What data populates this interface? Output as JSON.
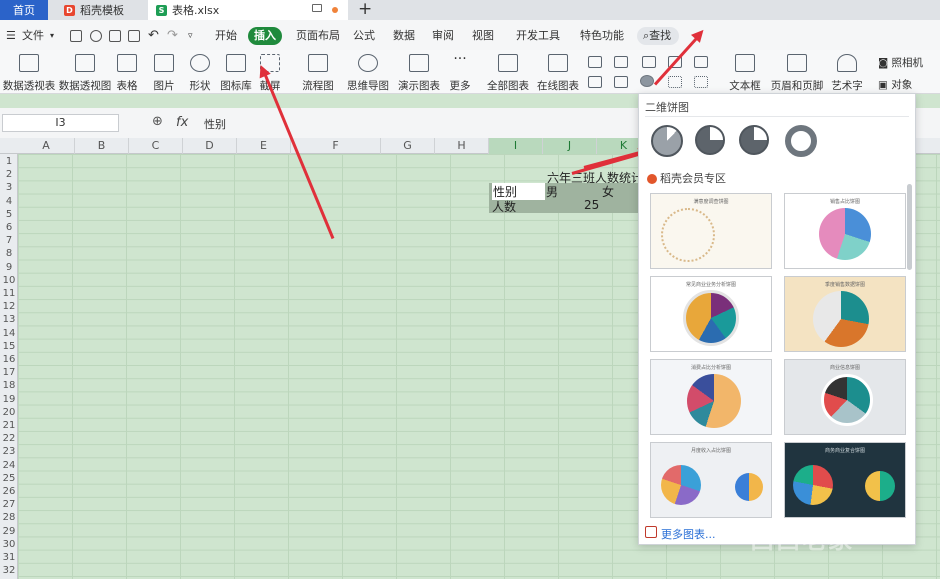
{
  "tabs": {
    "home": "首页",
    "template": "稻壳模板",
    "file": "表格.xlsx",
    "add_icon": "plus-icon"
  },
  "menu": {
    "file": "文件",
    "start": "开始",
    "insert": "插入",
    "page_layout": "页面布局",
    "formula": "公式",
    "data": "数据",
    "review": "审阅",
    "view": "视图",
    "developer": "开发工具",
    "special": "特色功能",
    "search": "查找"
  },
  "ribbon": {
    "pivot_table": "数据透视表",
    "pivot_chart": "数据透视图",
    "table": "表格",
    "picture": "图片",
    "shape": "形状",
    "icon_lib": "图标库",
    "screenshot": "截屏",
    "flowchart": "流程图",
    "mindmap": "思维导图",
    "demo_chart": "演示图表",
    "more": "更多",
    "all_charts": "全部图表",
    "online_chart": "在线图表",
    "textbox": "文本框",
    "header_footer": "页眉和页脚",
    "art_text": "艺术字",
    "camera": "照相机",
    "object": "对象"
  },
  "formula_bar": {
    "cell_ref": "I3",
    "fx": "fx",
    "value": "性别"
  },
  "columns": [
    "A",
    "B",
    "C",
    "D",
    "E",
    "F",
    "G",
    "H",
    "I",
    "J",
    "K"
  ],
  "rows": [
    "1",
    "2",
    "3",
    "4",
    "5",
    "6",
    "7",
    "8",
    "9",
    "10",
    "11",
    "12",
    "13",
    "14",
    "15",
    "16",
    "17",
    "18",
    "19",
    "20",
    "21",
    "22",
    "23",
    "24",
    "25",
    "26",
    "27",
    "28",
    "29",
    "30",
    "31",
    "32"
  ],
  "sheet": {
    "title": "六年三班人数统计",
    "row1": [
      "性别",
      "男",
      "女"
    ],
    "row2": [
      "人数",
      "25",
      ""
    ]
  },
  "dropdown": {
    "section_2d": "二维饼图",
    "section_vip": "稻壳会员专区",
    "more_charts": "更多图表...",
    "templates": [
      "满意度调查饼图",
      "销售占比饼图",
      "常见商业业务分析饼图",
      "季度销售数据饼图",
      "消费占比分析饼图",
      "商业信息饼图",
      "月度收入占比饼图",
      "商务商业复合饼图"
    ]
  },
  "colors": {
    "accent": "#1f8a3c",
    "home_tab": "#2b63c9",
    "arrow": "#e0303a",
    "grid_bg": "#cfe5cf",
    "link": "#2a6fd6"
  },
  "watermark": "西西老家"
}
